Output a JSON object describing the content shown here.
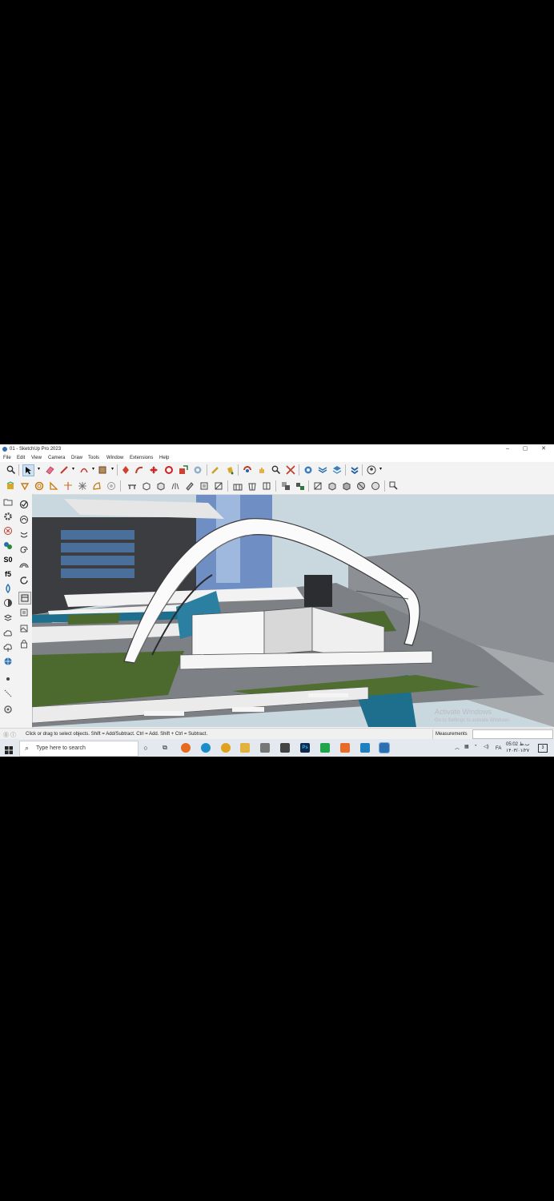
{
  "window": {
    "title": "01 - SketchUp Pro 2023",
    "controls": [
      "–",
      "▢",
      "✕"
    ]
  },
  "menu": [
    "File",
    "Edit",
    "View",
    "Camera",
    "Draw",
    "Tools",
    "Window",
    "Extensions",
    "Help"
  ],
  "status": {
    "hint": "Click or drag to select objects. Shift = Add/Subtract. Ctrl = Add. Shift + Ctrl = Subtract.",
    "measurements_label": "Measurements",
    "measurements_value": ""
  },
  "viewport": {
    "watermark_title": "Activate Windows",
    "watermark_sub": "Go to Settings to activate Windows."
  },
  "taskbar": {
    "search_placeholder": "Type here to search",
    "tray_lang": "FA",
    "clock_time": "05:02 ب.ظ",
    "clock_date": "۱۴۰۳/۰۱/۲۷"
  },
  "colors": {
    "accent": "#2d6fb3",
    "grass": "#4d6a2e",
    "water": "#1e6f8e",
    "sky": "#c9d8df"
  },
  "icons": {
    "start": "windows-logo-icon",
    "search": "search-icon"
  }
}
